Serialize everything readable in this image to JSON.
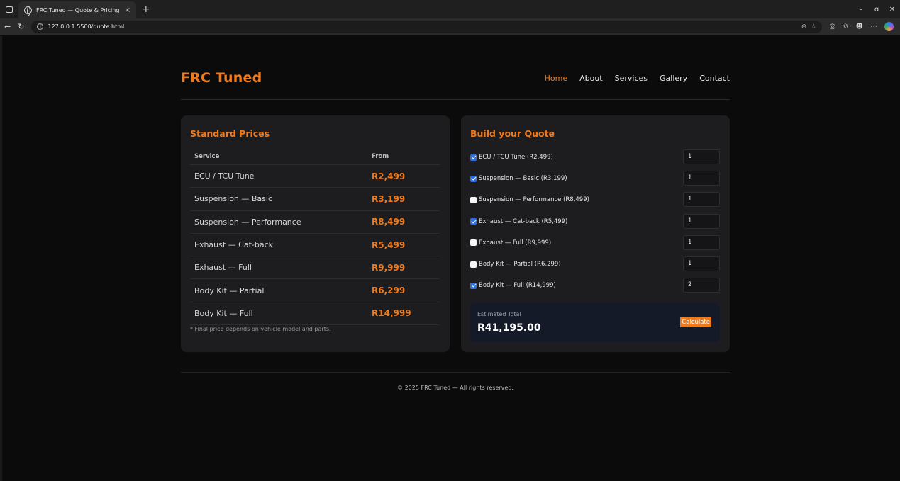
{
  "browser": {
    "tab_title": "FRC Tuned — Quote & Pricing",
    "tab_close": "×",
    "new_tab": "+",
    "url": "127.0.0.1:5500/quote.html",
    "controls": {
      "minimize": "–",
      "restore": "ɑ",
      "close": "✕"
    }
  },
  "header": {
    "logo": "FRC Tuned",
    "nav": [
      "Home",
      "About",
      "Services",
      "Gallery",
      "Contact"
    ],
    "active_nav": "Home"
  },
  "prices": {
    "title": "Standard Prices",
    "col_service": "Service",
    "col_from": "From",
    "rows": [
      {
        "service": "ECU / TCU Tune",
        "price": "R2,499"
      },
      {
        "service": "Suspension — Basic",
        "price": "R3,199"
      },
      {
        "service": "Suspension — Performance",
        "price": "R8,499"
      },
      {
        "service": "Exhaust — Cat-back",
        "price": "R5,499"
      },
      {
        "service": "Exhaust — Full",
        "price": "R9,999"
      },
      {
        "service": "Body Kit — Partial",
        "price": "R6,299"
      },
      {
        "service": "Body Kit — Full",
        "price": "R14,999"
      }
    ],
    "note": "* Final price depends on vehicle model and parts."
  },
  "quote": {
    "title": "Build your Quote",
    "items": [
      {
        "label": "ECU / TCU Tune (R2,499)",
        "checked": true,
        "qty": "1"
      },
      {
        "label": "Suspension — Basic (R3,199)",
        "checked": true,
        "qty": "1"
      },
      {
        "label": "Suspension — Performance (R8,499)",
        "checked": false,
        "qty": "1"
      },
      {
        "label": "Exhaust — Cat-back (R5,499)",
        "checked": true,
        "qty": "1"
      },
      {
        "label": "Exhaust — Full (R9,999)",
        "checked": false,
        "qty": "1"
      },
      {
        "label": "Body Kit — Partial (R6,299)",
        "checked": false,
        "qty": "1"
      },
      {
        "label": "Body Kit — Full (R14,999)",
        "checked": true,
        "qty": "2"
      }
    ],
    "total_label": "Estimated Total",
    "total_value": "R41,195.00",
    "calculate_label": "Calculate"
  },
  "footer": {
    "text": "© 2025 FRC Tuned — All rights reserved."
  },
  "colors": {
    "accent": "#f07a1a",
    "background": "#0b0b0c",
    "card": "#1d1d1f",
    "total_box": "#141a27",
    "checkbox_checked": "#2f6fdd"
  }
}
